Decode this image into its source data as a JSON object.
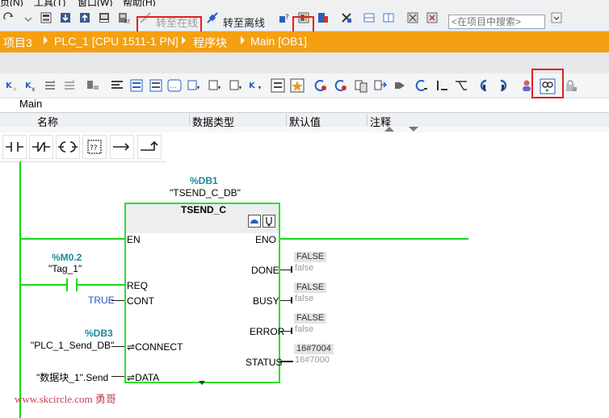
{
  "menu": [
    "页(N)",
    "工具(T)",
    "窗口(W)",
    "帮助(H)"
  ],
  "toolbar": {
    "go_online": "转至在线",
    "go_offline": "转至离线",
    "search_placeholder": "<在项目中搜索>"
  },
  "breadcrumb": [
    "项目3",
    "PLC_1 [CPU 1511-1 PN]",
    "程序块",
    "Main [OB1]"
  ],
  "interface": {
    "title": "Main",
    "columns": [
      "名称",
      "数据类型",
      "默认值",
      "注释"
    ]
  },
  "network": {
    "instance_db_address": "%DB1",
    "instance_db_name": "\"TSEND_C_DB\"",
    "block_name": "TSEND_C",
    "inputs": {
      "en": "EN",
      "req": "REQ",
      "cont": "CONT",
      "connect": "CONNECT",
      "data": "DATA"
    },
    "outputs": {
      "eno": "ENO",
      "done": "DONE",
      "busy": "BUSY",
      "error": "ERROR",
      "status": "STATUS"
    },
    "req_operand_address": "%M0.2",
    "req_operand_name": "\"Tag_1\"",
    "cont_value": "TRUE",
    "connect_operand_address": "%DB3",
    "connect_operand_name": "\"PLC_1_Send_DB\"",
    "data_operand": "\"数据块_1\".Send",
    "done_value": "FALSE",
    "done_monitor": "false",
    "busy_value": "FALSE",
    "busy_monitor": "false",
    "error_value": "FALSE",
    "error_monitor": "false",
    "status_value": "16#7004",
    "status_monitor": "16#7000",
    "inout_marker": "⇌"
  },
  "watermark": "www.skcircle.com 勇哥",
  "colors": {
    "breadcrumb_bg": "#f5a012",
    "power_flow": "#17d817",
    "highlight": "#e02020",
    "operand_address": "#1a8a9a"
  }
}
